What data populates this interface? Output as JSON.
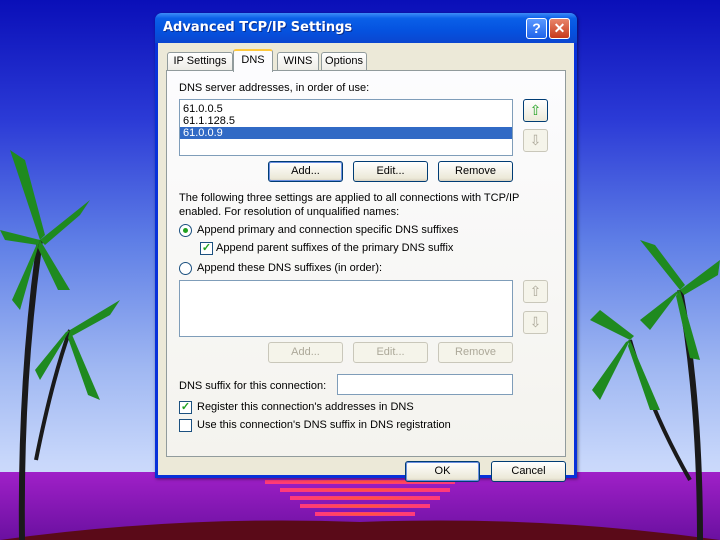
{
  "window": {
    "title": "Advanced TCP/IP Settings",
    "help_label": "?",
    "close_label": "✕"
  },
  "tabs": [
    {
      "label": "IP Settings"
    },
    {
      "label": "DNS"
    },
    {
      "label": "WINS"
    },
    {
      "label": "Options"
    }
  ],
  "dns": {
    "servers_label": "DNS server addresses, in order of use:",
    "servers": [
      "61.0.0.5",
      "61.1.128.5",
      "61.0.0.9"
    ],
    "selected_index": 2,
    "add_label": "Add...",
    "edit_label": "Edit...",
    "remove_label": "Remove",
    "info_text_1": "The following three settings are applied to all connections with TCP/IP",
    "info_text_2": "enabled. For resolution of unqualified names:",
    "radio_primary_label": "Append primary and connection specific DNS suffixes",
    "check_parent_label": "Append parent suffixes of the primary DNS suffix",
    "radio_these_label": "Append these DNS suffixes (in order):",
    "suffix_add_label": "Add...",
    "suffix_edit_label": "Edit...",
    "suffix_remove_label": "Remove",
    "conn_suffix_label": "DNS suffix for this connection:",
    "conn_suffix_value": "",
    "register_label": "Register this connection's addresses in DNS",
    "use_suffix_label": "Use this connection's DNS suffix in DNS registration",
    "radio_primary_checked": true,
    "check_parent_checked": true,
    "register_checked": true,
    "use_suffix_checked": false
  },
  "footer": {
    "ok_label": "OK",
    "cancel_label": "Cancel"
  },
  "icons": {
    "up": "up-arrow-icon",
    "down": "down-arrow-icon"
  },
  "colors": {
    "selection": "#316ac5",
    "titlebar": "#0552df",
    "accent_green": "#21a121"
  }
}
